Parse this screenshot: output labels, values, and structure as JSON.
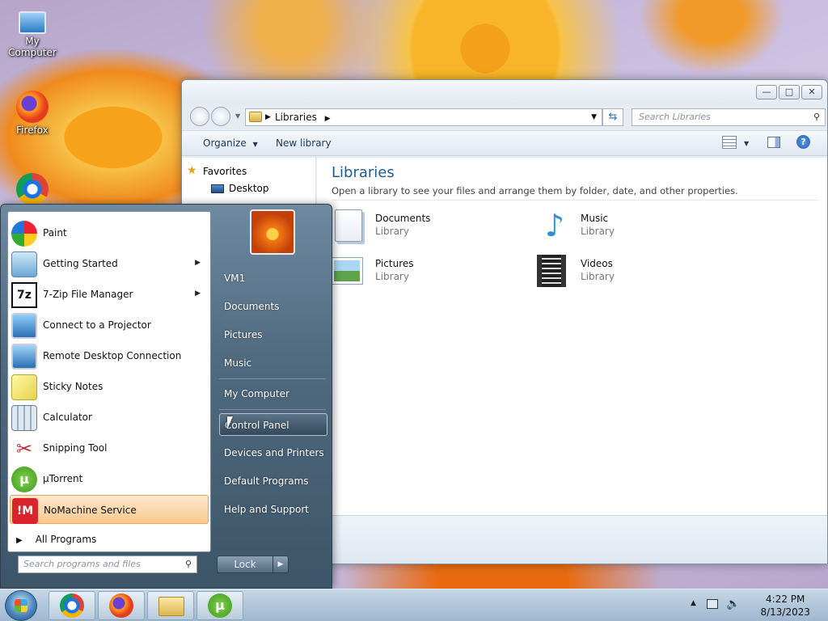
{
  "desktop": {
    "icons": [
      {
        "label": "My Computer"
      },
      {
        "label": "Firefox"
      }
    ]
  },
  "explorer": {
    "address": {
      "segment": "Libraries"
    },
    "search_placeholder": "Search Libraries",
    "toolbar": {
      "organize": "Organize",
      "new_library": "New library"
    },
    "nav": {
      "favorites": "Favorites",
      "desktop": "Desktop"
    },
    "heading": "Libraries",
    "subheading": "Open a library to see your files and arrange them by folder, date, and other properties.",
    "libraries": [
      {
        "name": "Documents",
        "type": "Library"
      },
      {
        "name": "Music",
        "type": "Library"
      },
      {
        "name": "Pictures",
        "type": "Library"
      },
      {
        "name": "Videos",
        "type": "Library"
      }
    ]
  },
  "start_menu": {
    "programs": [
      {
        "label": "Paint"
      },
      {
        "label": "Getting Started"
      },
      {
        "label": "7-Zip File Manager",
        "icon_text": "7z"
      },
      {
        "label": "Connect to a Projector"
      },
      {
        "label": "Remote Desktop Connection"
      },
      {
        "label": "Sticky Notes"
      },
      {
        "label": "Calculator"
      },
      {
        "label": "Snipping Tool"
      },
      {
        "label": "µTorrent"
      },
      {
        "label": "NoMachine Service",
        "icon_text": "!M"
      }
    ],
    "all_programs": "All Programs",
    "search_placeholder": "Search programs and files",
    "right_links": [
      "VM1",
      "Documents",
      "Pictures",
      "Music",
      "My Computer",
      "Control Panel",
      "Devices and Printers",
      "Default Programs",
      "Help and Support"
    ],
    "lock_label": "Lock"
  },
  "taskbar": {
    "time": "4:22 PM",
    "date": "8/13/2023"
  },
  "colors": {
    "accent": "#1e5c8b",
    "highlight": "#f9c98e"
  }
}
